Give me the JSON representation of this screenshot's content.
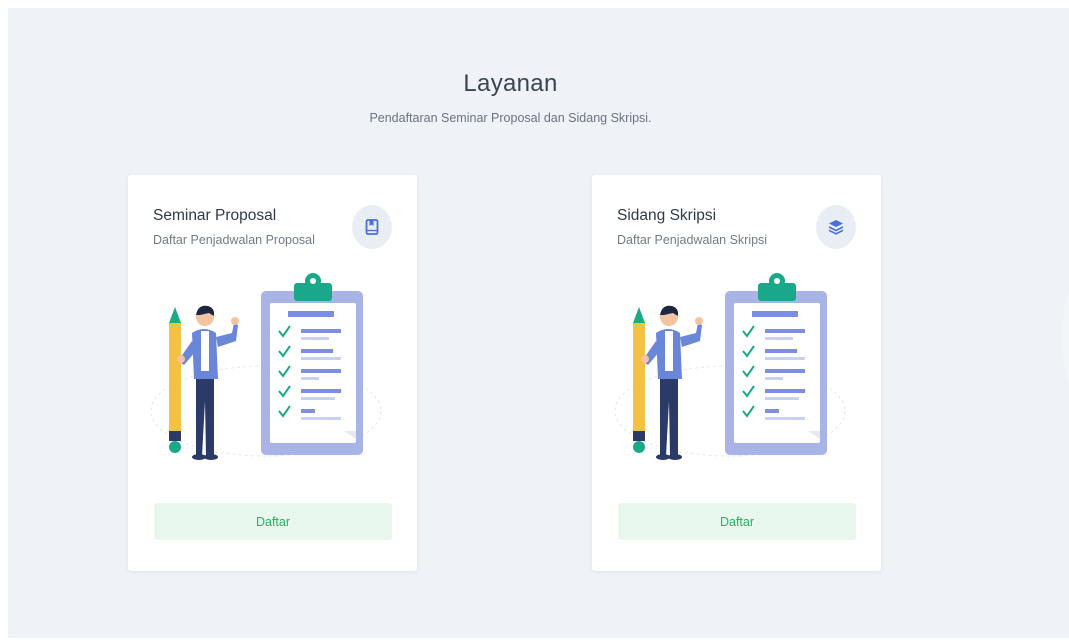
{
  "section": {
    "title": "Layanan",
    "subtitle": "Pendaftaran Seminar Proposal dan Sidang Skripsi."
  },
  "cards": [
    {
      "title": "Seminar Proposal",
      "subtitle": "Daftar Penjadwalan Proposal",
      "icon": "book-icon",
      "button_label": "Daftar"
    },
    {
      "title": "Sidang Skripsi",
      "subtitle": "Daftar Penjadwalan Skripsi",
      "icon": "layers-icon",
      "button_label": "Daftar"
    }
  ],
  "colors": {
    "background": "#eff3f7",
    "card": "#ffffff",
    "icon_color": "#4a6fd8",
    "button_bg": "#e9f8ef",
    "button_text": "#2cae5e",
    "clipboard": "#a8b3e6",
    "clip_top": "#19a98a"
  }
}
